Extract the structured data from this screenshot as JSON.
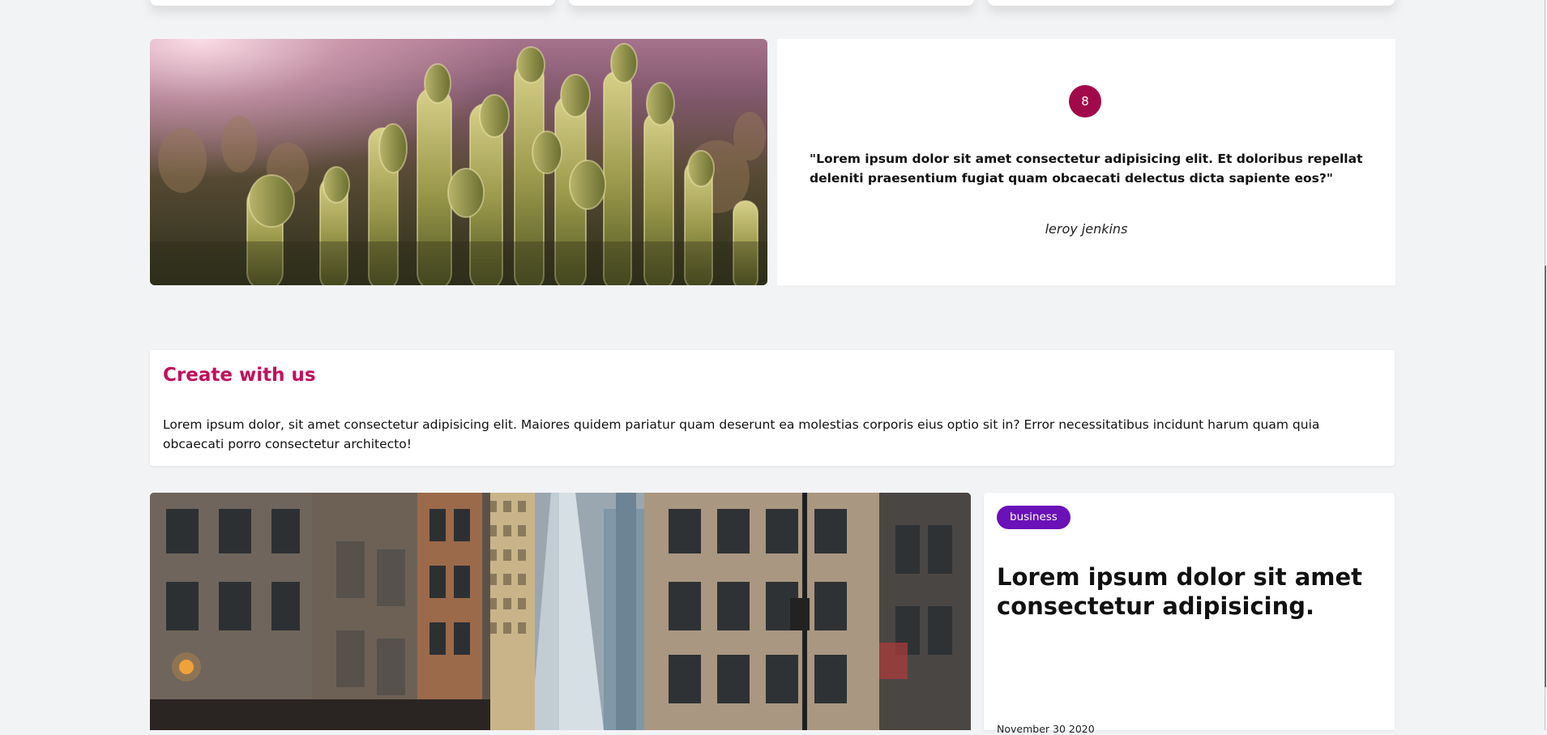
{
  "testimonial": {
    "number": "8",
    "quote": "\"Lorem ipsum dolor sit amet consectetur adipisicing elit. Et doloribus repellat deleniti praesentium fugiat quam obcaecati delectus dicta sapiente eos?\"",
    "author": "leroy jenkins",
    "accent_color": "#a10a4a"
  },
  "create_section": {
    "title": "Create with us",
    "body": "Lorem ipsum dolor, sit amet consectetur adipisicing elit. Maiores quidem pariatur quam deserunt ea molestias corporis eius optio sit in? Error necessitatibus incidunt harum quam quia obcaecati porro consectetur architecto!",
    "title_color": "#c0105d"
  },
  "article": {
    "tag": "business",
    "tag_color": "#6a11b7",
    "title": "Lorem ipsum dolor sit amet consectetur adipisicing.",
    "date": "November 30 2020"
  },
  "images": {
    "cactus": "cactus-photo",
    "city": "city-street-photo"
  },
  "colors": {
    "page_background": "#f2f3f5",
    "card_background": "#ffffff"
  }
}
